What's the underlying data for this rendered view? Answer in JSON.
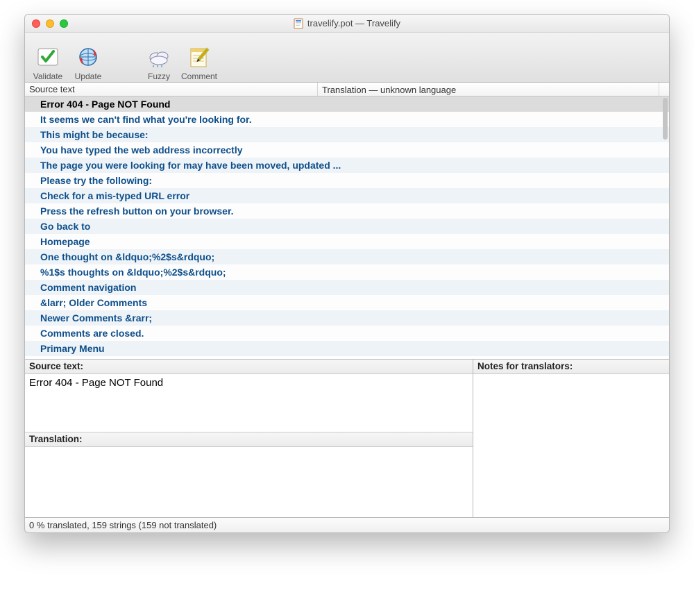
{
  "window": {
    "title": "travelify.pot — Travelify"
  },
  "toolbar": {
    "validate": "Validate",
    "update": "Update",
    "fuzzy": "Fuzzy",
    "comment": "Comment"
  },
  "columns": {
    "source": "Source text",
    "translation": "Translation — unknown language"
  },
  "rows": [
    {
      "text": "Error 404 - Page NOT Found",
      "selected": true
    },
    {
      "text": "It seems we can't find what you're looking for."
    },
    {
      "text": "This might be because:"
    },
    {
      "text": "You have typed the web address incorrectly"
    },
    {
      "text": "The page you were looking for may have been moved, updated ..."
    },
    {
      "text": "Please try the following:"
    },
    {
      "text": "Check for a mis-typed URL error"
    },
    {
      "text": "Press the refresh button on your browser."
    },
    {
      "text": "Go back to"
    },
    {
      "text": "Homepage"
    },
    {
      "text": "One thought on &ldquo;%2$s&rdquo;"
    },
    {
      "text": "%1$s thoughts on &ldquo;%2$s&rdquo;"
    },
    {
      "text": "Comment navigation"
    },
    {
      "text": "&larr; Older Comments"
    },
    {
      "text": "Newer Comments &rarr;"
    },
    {
      "text": "Comments are closed."
    },
    {
      "text": "Primary Menu"
    }
  ],
  "panels": {
    "source_label": "Source text:",
    "source_value": "Error 404 - Page NOT Found",
    "translation_label": "Translation:",
    "translation_value": "",
    "notes_label": "Notes for translators:"
  },
  "status": "0 % translated, 159 strings (159 not translated)"
}
